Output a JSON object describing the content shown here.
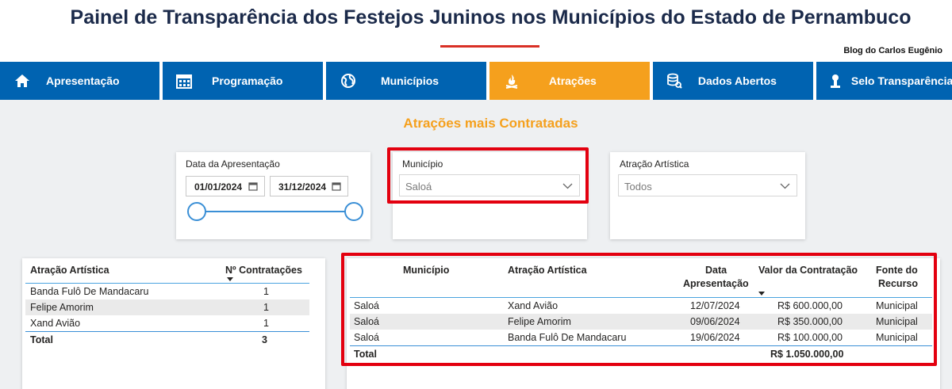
{
  "header": {
    "title": "Painel de Transparência dos Festejos Juninos nos Municípios do Estado de Pernambuco",
    "blog": "Blog do Carlos Eugênio"
  },
  "nav": {
    "items": [
      {
        "label": "Apresentação",
        "icon": "home-icon"
      },
      {
        "label": "Programação",
        "icon": "calendar-icon"
      },
      {
        "label": "Municípios",
        "icon": "globe-icon"
      },
      {
        "label": "Atrações",
        "icon": "bonfire-icon"
      },
      {
        "label": "Dados Abertos",
        "icon": "database-icon"
      },
      {
        "label": "Selo Transparência",
        "icon": "user-icon"
      }
    ],
    "active": "Atrações"
  },
  "section_title": "Atrações mais Contratadas",
  "filters": {
    "date": {
      "label": "Data da Apresentação",
      "start": "01/01/2024",
      "end": "31/12/2024"
    },
    "municipio": {
      "label": "Município",
      "value": "Saloá"
    },
    "atracao": {
      "label": "Atração Artística",
      "value": "Todos"
    }
  },
  "summary_table": {
    "headers": [
      "Atração Artística",
      "Nº Contratações"
    ],
    "rows": [
      {
        "atracao": "Banda Fulô De Mandacaru",
        "count": "1"
      },
      {
        "atracao": "Felipe Amorim",
        "count": "1"
      },
      {
        "atracao": "Xand Avião",
        "count": "1"
      }
    ],
    "total_label": "Total",
    "total_value": "3"
  },
  "detail_table": {
    "headers": {
      "municipio": "Município",
      "atracao": "Atração Artística",
      "data_1": "Data",
      "data_2": "Apresentação",
      "valor": "Valor da Contratação",
      "fonte_1": "Fonte do",
      "fonte_2": "Recurso"
    },
    "rows": [
      {
        "municipio": "Saloá",
        "atracao": "Xand Avião",
        "data": "12/07/2024",
        "valor": "R$ 600.000,00",
        "fonte": "Municipal"
      },
      {
        "municipio": "Saloá",
        "atracao": "Felipe Amorim",
        "data": "09/06/2024",
        "valor": "R$ 350.000,00",
        "fonte": "Municipal"
      },
      {
        "municipio": "Saloá",
        "atracao": "Banda Fulô De Mandacaru",
        "data": "19/06/2024",
        "valor": "R$ 100.000,00",
        "fonte": "Municipal"
      }
    ],
    "total_label": "Total",
    "total_value": "R$ 1.050.000,00"
  },
  "colors": {
    "nav_blue": "#0063b1",
    "nav_active": "#f5a01d",
    "title": "#1b2a4a",
    "highlight": "#e3000f"
  }
}
